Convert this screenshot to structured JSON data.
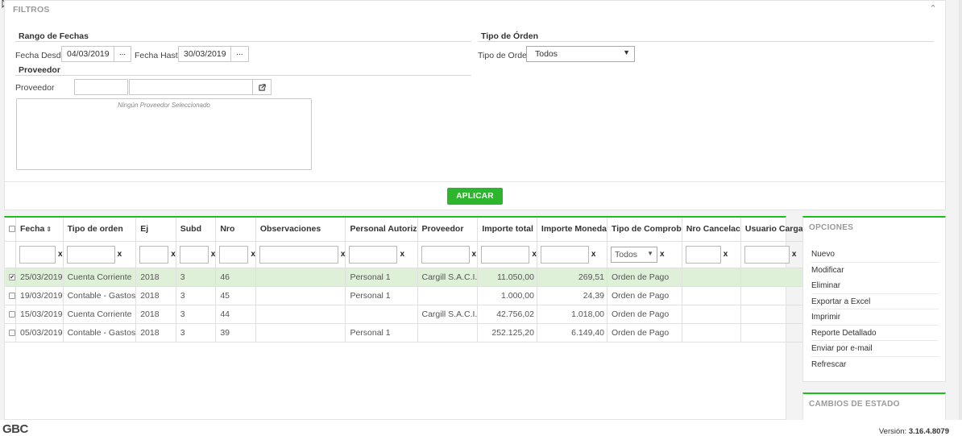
{
  "filters": {
    "title": "FILTROS",
    "date_range": {
      "title": "Rango de Fechas",
      "from_label": "Fecha Desde",
      "from_value": "04/03/2019",
      "to_label": "Fecha Hasta",
      "to_value": "30/03/2019",
      "picker_label": "..."
    },
    "order_type": {
      "title": "Tipo de Órden",
      "label": "Tipo de Orden",
      "value": "Todos"
    },
    "supplier": {
      "title": "Proveedor",
      "label": "Proveedor",
      "code_value": "",
      "name_value": "",
      "empty_text": "Ningún Proveedor Seleccionado"
    },
    "apply_label": "APLICAR"
  },
  "grid": {
    "columns": [
      "Fecha",
      "Tipo de orden",
      "Ej",
      "Subd",
      "Nro",
      "Observaciones",
      "Personal Autoriz",
      "Proveedor",
      "Importe total",
      "Importe Moneda",
      "Tipo de Comprob",
      "Nro Cancelac",
      "Usuario Carga"
    ],
    "filter_clear": "x",
    "comprob_filter_value": "Todos",
    "rows": [
      {
        "selected": true,
        "fecha": "25/03/2019",
        "tipo": "Cuenta Corriente",
        "ej": "2018",
        "subd": "3",
        "nro": "46",
        "obs": "",
        "personal": "Personal 1",
        "proveedor": "Cargill S.A.C.I.",
        "importe": "11.050,00",
        "moneda": "269,51",
        "comprob": "Orden de Pago",
        "cancel": "",
        "usuario": ""
      },
      {
        "selected": false,
        "fecha": "19/03/2019",
        "tipo": "Contable - Gastos",
        "ej": "2018",
        "subd": "3",
        "nro": "45",
        "obs": "",
        "personal": "Personal 1",
        "proveedor": "",
        "importe": "1.000,00",
        "moneda": "24,39",
        "comprob": "Orden de Pago",
        "cancel": "",
        "usuario": ""
      },
      {
        "selected": false,
        "fecha": "15/03/2019",
        "tipo": "Cuenta Corriente",
        "ej": "2018",
        "subd": "3",
        "nro": "44",
        "obs": "",
        "personal": "",
        "proveedor": "Cargill S.A.C.I.",
        "importe": "42.756,02",
        "moneda": "1.018,00",
        "comprob": "Orden de Pago",
        "cancel": "",
        "usuario": ""
      },
      {
        "selected": false,
        "fecha": "05/03/2019",
        "tipo": "Contable - Gastos",
        "ej": "2018",
        "subd": "3",
        "nro": "39",
        "obs": "",
        "personal": "Personal 1",
        "proveedor": "",
        "importe": "252.125,20",
        "moneda": "6.149,40",
        "comprob": "Orden de Pago",
        "cancel": "",
        "usuario": ""
      }
    ]
  },
  "options": {
    "title": "OPCIONES",
    "items": [
      "Nuevo",
      "Modificar",
      "Eliminar",
      "Exportar a Excel",
      "Imprimir",
      "Reporte Detallado",
      "Enviar por e-mail",
      "Refrescar"
    ],
    "highlight_color": "#ffff5a"
  },
  "status_changes": {
    "title": "CAMBIOS DE ESTADO"
  },
  "footer": {
    "logo": "GBC",
    "version_label": "Versión:",
    "version_value": "3.16.4.8079"
  },
  "colors": {
    "accent": "#19c219",
    "apply_button": "#2db62d",
    "selected_row": "#dff0d8"
  }
}
